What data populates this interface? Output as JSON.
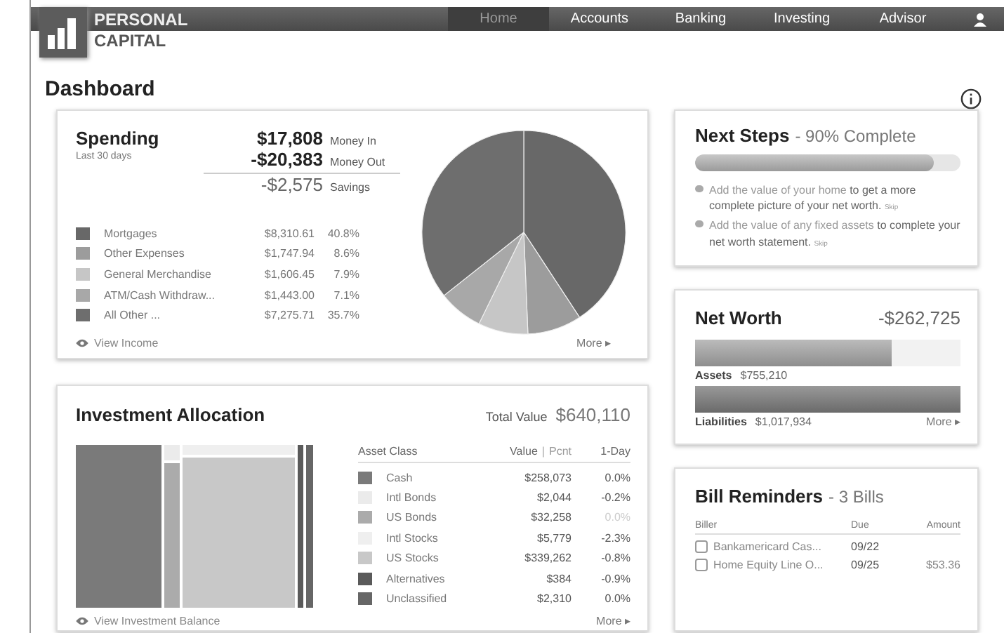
{
  "brand": {
    "line1": "PERSONAL",
    "line2": "CAPITAL"
  },
  "nav": [
    {
      "label": "Home",
      "selected": true
    },
    {
      "label": "Accounts",
      "selected": false
    },
    {
      "label": "Banking",
      "selected": false
    },
    {
      "label": "Investing",
      "selected": false
    },
    {
      "label": "Advisor",
      "selected": false
    }
  ],
  "page_title": "Dashboard",
  "spending": {
    "title": "Spending",
    "subtitle": "Last 30 days",
    "summary": [
      {
        "amount": "$17,808",
        "label": "Money In",
        "kind": "in"
      },
      {
        "amount": "-$20,383",
        "label": "Money Out",
        "kind": "out"
      },
      {
        "amount": "-$2,575",
        "label": "Savings",
        "kind": "total"
      }
    ],
    "items": [
      {
        "amount": "$8,310.61",
        "percent": "40.8%",
        "color": "#686868"
      },
      {
        "amount": "$1,747.94",
        "percent": "8.6%",
        "color": "#9c9c9c"
      },
      {
        "amount": "$1,606.45",
        "percent": "7.9%",
        "color": "#c6c6c6"
      },
      {
        "amount": "$1,443.00",
        "percent": "7.1%",
        "color": "#a8a8a8"
      },
      {
        "amount": "$7,275.71",
        "percent": "35.7%",
        "color": "#6e6e6e"
      }
    ],
    "chart_data": {
      "type": "pie",
      "categories": [
        "Mortgages",
        "Other Expenses",
        "General Merchandise",
        "ATM/Cash Withdraw...",
        "All Other ..."
      ],
      "values": [
        40.8,
        8.6,
        7.9,
        7.1,
        35.7
      ]
    },
    "footer_link": "View Income",
    "more": "More ▸"
  },
  "allocation": {
    "title": "Investment Allocation",
    "total_label": "Total Value",
    "total": "$640,110",
    "columns": [
      "Asset Class",
      "Value",
      "Pcnt",
      "1-Day"
    ],
    "column_separator": "|",
    "rows": [
      {
        "name": "Cash",
        "value": "$258,073",
        "day": "0.0%",
        "color": "#7a7a7a",
        "muted": false
      },
      {
        "name": "Intl Bonds",
        "value": "$2,044",
        "day": "-0.2%",
        "color": "#ebebeb",
        "muted": false
      },
      {
        "name": "US Bonds",
        "value": "$32,258",
        "day": "0.0%",
        "color": "#ababab",
        "muted": true
      },
      {
        "name": "Intl Stocks",
        "value": "$5,779",
        "day": "-2.3%",
        "color": "#efefef",
        "muted": false
      },
      {
        "name": "US Stocks",
        "value": "$339,262",
        "day": "-0.8%",
        "color": "#c8c8c8",
        "muted": false
      },
      {
        "name": "Alternatives",
        "value": "$384",
        "day": "-0.9%",
        "color": "#5a5a5a",
        "muted": false
      },
      {
        "name": "Unclassified",
        "value": "$2,310",
        "day": "0.0%",
        "color": "#666666",
        "muted": false
      }
    ],
    "footer_link": "View Investment Balance",
    "more": "More ▸"
  },
  "next_steps": {
    "title": "Next Steps",
    "status": "- 90% Complete",
    "level": 0.9,
    "items": [
      {
        "link": "Add the value of your home",
        "text": " to get a more complete picture of your net worth.",
        "skip": "Skip"
      },
      {
        "link": "Add the value of any fixed assets",
        "text": " to complete your net worth statement.",
        "skip": "Skip"
      }
    ]
  },
  "net_worth": {
    "title": "Net Worth",
    "total": "-$262,725",
    "bars": [
      {
        "label": "Assets",
        "value": "$755,210",
        "level": 0.74,
        "kind": "assets"
      },
      {
        "label": "Liabilities",
        "value": "$1,017,934",
        "level": 1.0,
        "kind": "liabilities"
      }
    ],
    "more": "More ▸"
  },
  "bills": {
    "title": "Bill Reminders",
    "count": "- 3 Bills",
    "columns": [
      "Biller",
      "Due",
      "Amount"
    ],
    "rows": [
      {
        "biller": "Bankamericard Cas...",
        "due": "09/22",
        "checked": false
      },
      {
        "biller": "Home Equity Line O...",
        "due": "09/25",
        "amount": "$53.36",
        "checked": false
      }
    ]
  }
}
